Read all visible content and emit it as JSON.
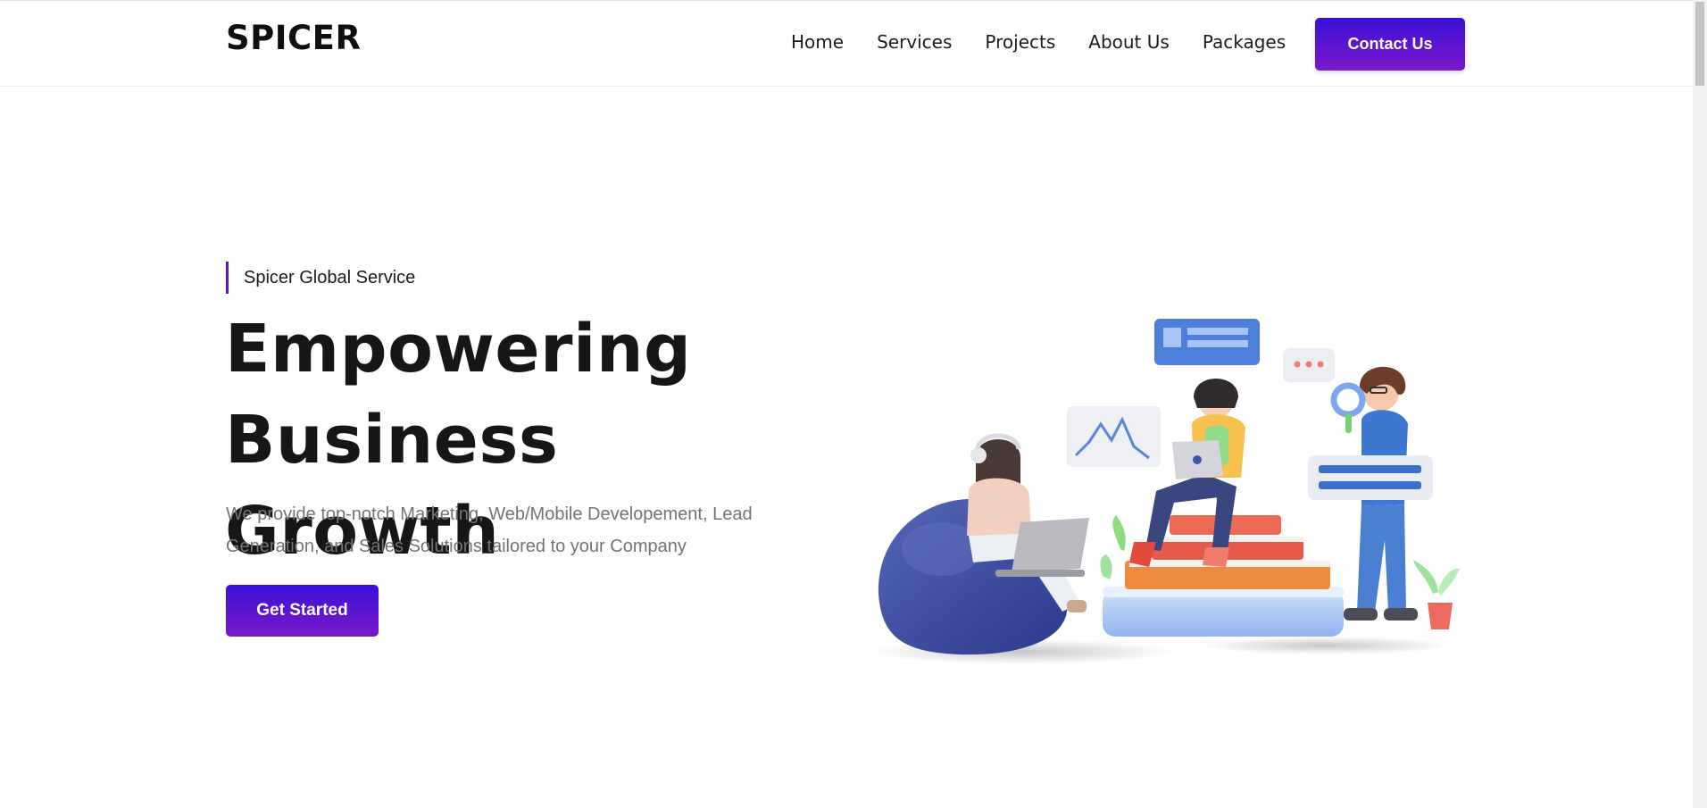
{
  "header": {
    "logo": "SPICER",
    "nav": [
      "Home",
      "Services",
      "Projects",
      "About Us",
      "Packages"
    ],
    "contact_label": "Contact Us"
  },
  "hero": {
    "eyebrow": "Spicer Global Service",
    "headline_line1": "Empowering",
    "headline_line2": "Business Growth",
    "subtext": "We provide top-notch Marketing, Web/Mobile Developement, Lead Generation, and Sales Solutions tailored to your Company",
    "cta_label": "Get Started"
  },
  "colors": {
    "brand_gradient_start": "#3a10d8",
    "brand_gradient_end": "#7a19c9",
    "accent_bar": "#5a16c9",
    "text_dark": "#161616",
    "text_muted": "#737378"
  }
}
